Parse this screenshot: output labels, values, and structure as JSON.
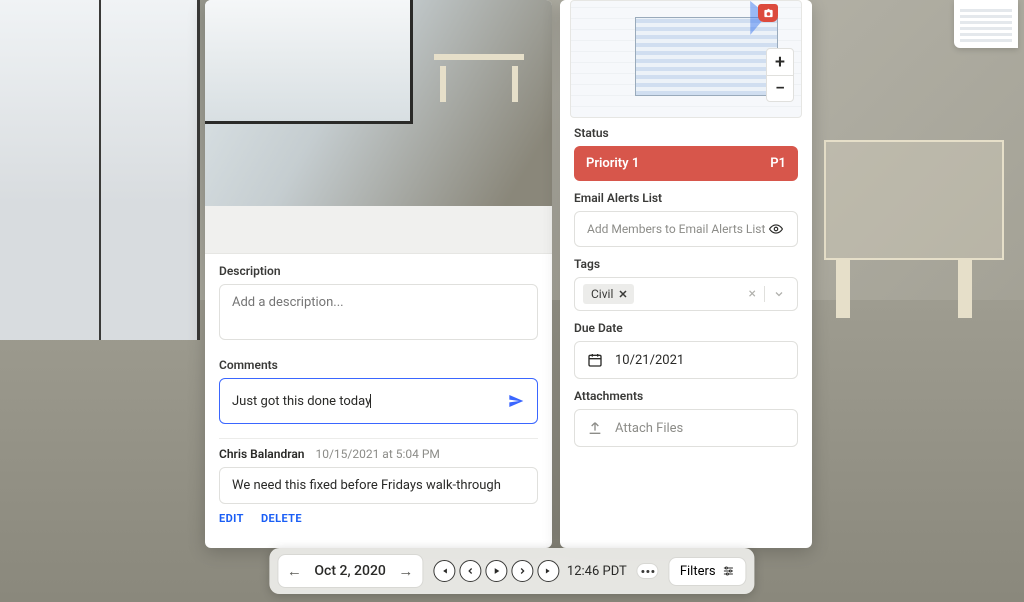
{
  "left": {
    "description_label": "Description",
    "description_placeholder": "Add a description...",
    "comments_label": "Comments",
    "comment_input_value": "Just got this done today",
    "existing_comment": {
      "author": "Chris Balandran",
      "timestamp": "10/15/2021 at 5:04 PM",
      "body": "We need this fixed before Fridays walk-through"
    },
    "actions": {
      "edit": "EDIT",
      "delete": "DELETE"
    }
  },
  "right": {
    "status_label": "Status",
    "status_value": "Priority 1",
    "status_code": "P1",
    "email_label": "Email Alerts List",
    "email_placeholder": "Add Members to Email Alerts List",
    "tags_label": "Tags",
    "tags": [
      "Civil"
    ],
    "due_label": "Due Date",
    "due_value": "10/21/2021",
    "attach_label": "Attachments",
    "attach_placeholder": "Attach Files",
    "zoom": {
      "in": "+",
      "out": "−"
    }
  },
  "toolbar": {
    "date": "Oct 2, 2020",
    "time": "12:46 PDT",
    "filters_label": "Filters"
  },
  "colors": {
    "accent_red": "#d7564b",
    "accent_blue": "#3a66ff",
    "link_blue": "#1a5ef5"
  }
}
